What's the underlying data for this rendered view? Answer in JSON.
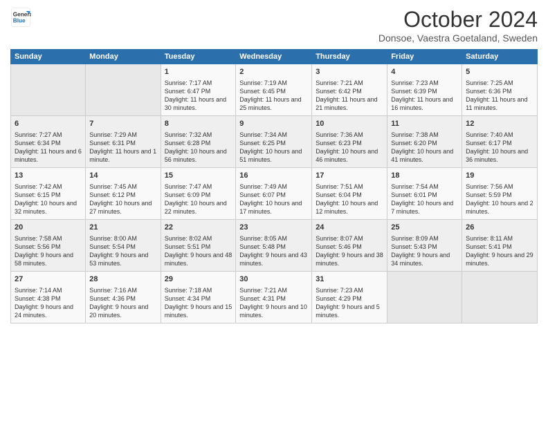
{
  "header": {
    "logo_line1": "General",
    "logo_line2": "Blue",
    "month": "October 2024",
    "location": "Donsoe, Vaestra Goetaland, Sweden"
  },
  "days_of_week": [
    "Sunday",
    "Monday",
    "Tuesday",
    "Wednesday",
    "Thursday",
    "Friday",
    "Saturday"
  ],
  "weeks": [
    [
      {
        "day": "",
        "text": ""
      },
      {
        "day": "",
        "text": ""
      },
      {
        "day": "1",
        "text": "Sunrise: 7:17 AM\nSunset: 6:47 PM\nDaylight: 11 hours and 30 minutes."
      },
      {
        "day": "2",
        "text": "Sunrise: 7:19 AM\nSunset: 6:45 PM\nDaylight: 11 hours and 25 minutes."
      },
      {
        "day": "3",
        "text": "Sunrise: 7:21 AM\nSunset: 6:42 PM\nDaylight: 11 hours and 21 minutes."
      },
      {
        "day": "4",
        "text": "Sunrise: 7:23 AM\nSunset: 6:39 PM\nDaylight: 11 hours and 16 minutes."
      },
      {
        "day": "5",
        "text": "Sunrise: 7:25 AM\nSunset: 6:36 PM\nDaylight: 11 hours and 11 minutes."
      }
    ],
    [
      {
        "day": "6",
        "text": "Sunrise: 7:27 AM\nSunset: 6:34 PM\nDaylight: 11 hours and 6 minutes."
      },
      {
        "day": "7",
        "text": "Sunrise: 7:29 AM\nSunset: 6:31 PM\nDaylight: 11 hours and 1 minute."
      },
      {
        "day": "8",
        "text": "Sunrise: 7:32 AM\nSunset: 6:28 PM\nDaylight: 10 hours and 56 minutes."
      },
      {
        "day": "9",
        "text": "Sunrise: 7:34 AM\nSunset: 6:25 PM\nDaylight: 10 hours and 51 minutes."
      },
      {
        "day": "10",
        "text": "Sunrise: 7:36 AM\nSunset: 6:23 PM\nDaylight: 10 hours and 46 minutes."
      },
      {
        "day": "11",
        "text": "Sunrise: 7:38 AM\nSunset: 6:20 PM\nDaylight: 10 hours and 41 minutes."
      },
      {
        "day": "12",
        "text": "Sunrise: 7:40 AM\nSunset: 6:17 PM\nDaylight: 10 hours and 36 minutes."
      }
    ],
    [
      {
        "day": "13",
        "text": "Sunrise: 7:42 AM\nSunset: 6:15 PM\nDaylight: 10 hours and 32 minutes."
      },
      {
        "day": "14",
        "text": "Sunrise: 7:45 AM\nSunset: 6:12 PM\nDaylight: 10 hours and 27 minutes."
      },
      {
        "day": "15",
        "text": "Sunrise: 7:47 AM\nSunset: 6:09 PM\nDaylight: 10 hours and 22 minutes."
      },
      {
        "day": "16",
        "text": "Sunrise: 7:49 AM\nSunset: 6:07 PM\nDaylight: 10 hours and 17 minutes."
      },
      {
        "day": "17",
        "text": "Sunrise: 7:51 AM\nSunset: 6:04 PM\nDaylight: 10 hours and 12 minutes."
      },
      {
        "day": "18",
        "text": "Sunrise: 7:54 AM\nSunset: 6:01 PM\nDaylight: 10 hours and 7 minutes."
      },
      {
        "day": "19",
        "text": "Sunrise: 7:56 AM\nSunset: 5:59 PM\nDaylight: 10 hours and 2 minutes."
      }
    ],
    [
      {
        "day": "20",
        "text": "Sunrise: 7:58 AM\nSunset: 5:56 PM\nDaylight: 9 hours and 58 minutes."
      },
      {
        "day": "21",
        "text": "Sunrise: 8:00 AM\nSunset: 5:54 PM\nDaylight: 9 hours and 53 minutes."
      },
      {
        "day": "22",
        "text": "Sunrise: 8:02 AM\nSunset: 5:51 PM\nDaylight: 9 hours and 48 minutes."
      },
      {
        "day": "23",
        "text": "Sunrise: 8:05 AM\nSunset: 5:48 PM\nDaylight: 9 hours and 43 minutes."
      },
      {
        "day": "24",
        "text": "Sunrise: 8:07 AM\nSunset: 5:46 PM\nDaylight: 9 hours and 38 minutes."
      },
      {
        "day": "25",
        "text": "Sunrise: 8:09 AM\nSunset: 5:43 PM\nDaylight: 9 hours and 34 minutes."
      },
      {
        "day": "26",
        "text": "Sunrise: 8:11 AM\nSunset: 5:41 PM\nDaylight: 9 hours and 29 minutes."
      }
    ],
    [
      {
        "day": "27",
        "text": "Sunrise: 7:14 AM\nSunset: 4:38 PM\nDaylight: 9 hours and 24 minutes."
      },
      {
        "day": "28",
        "text": "Sunrise: 7:16 AM\nSunset: 4:36 PM\nDaylight: 9 hours and 20 minutes."
      },
      {
        "day": "29",
        "text": "Sunrise: 7:18 AM\nSunset: 4:34 PM\nDaylight: 9 hours and 15 minutes."
      },
      {
        "day": "30",
        "text": "Sunrise: 7:21 AM\nSunset: 4:31 PM\nDaylight: 9 hours and 10 minutes."
      },
      {
        "day": "31",
        "text": "Sunrise: 7:23 AM\nSunset: 4:29 PM\nDaylight: 9 hours and 5 minutes."
      },
      {
        "day": "",
        "text": ""
      },
      {
        "day": "",
        "text": ""
      }
    ]
  ]
}
